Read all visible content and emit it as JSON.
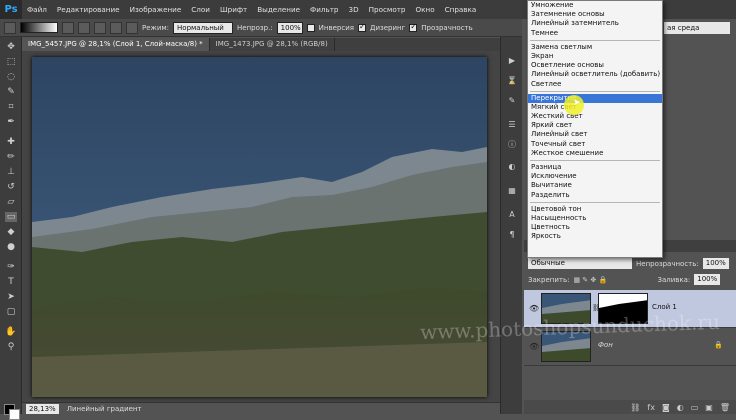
{
  "app": {
    "logo": "Ps"
  },
  "menu": [
    "Файл",
    "Редактирование",
    "Изображение",
    "Слои",
    "Шрифт",
    "Выделение",
    "Фильтр",
    "3D",
    "Просмотр",
    "Окно",
    "Справка"
  ],
  "options": {
    "mode_label": "Режим:",
    "mode_value": "Нормальный",
    "opacity_label": "Непрозр.:",
    "opacity_value": "100%",
    "inversion_label": "Инверсия",
    "dither_label": "Дизеринг",
    "transparency_label": "Прозрачность"
  },
  "workspace": {
    "value": "ая среда"
  },
  "tabs": [
    {
      "label": "IMG_5457.JPG @ 28,1% (Слой 1, Слой-маска/8) *"
    },
    {
      "label": "IMG_1473.JPG @ 28,1% (RGB/8)"
    }
  ],
  "status": {
    "zoom": "28,13%",
    "tool": "Линейный градиент"
  },
  "blend_menu": {
    "groups": [
      [
        "Умножение",
        "Затемнение основы",
        "Линейный затемнитель",
        "Темнее"
      ],
      [
        "Замена светлым",
        "Экран",
        "Осветление основы",
        "Линейный осветлитель (добавить)",
        "Светлее"
      ],
      [
        "Перекрытие",
        "Мягкий свет",
        "Жесткий свет",
        "Яркий свет",
        "Линейный свет",
        "Точечный свет",
        "Жесткое смешение"
      ],
      [
        "Разница",
        "Исключение",
        "Вычитание",
        "Разделить"
      ],
      [
        "Цветовой тон",
        "Насыщенность",
        "Цветность",
        "Яркость"
      ]
    ],
    "selected": "Перекрытие"
  },
  "layers": {
    "blend_value": "Обычные",
    "opacity_label": "Непрозрачность:",
    "opacity_value": "100%",
    "lock_label": "Закрепить:",
    "fill_label": "Заливка:",
    "fill_value": "100%",
    "items": [
      {
        "name": "Слой 1",
        "active": true
      },
      {
        "name": "Фон",
        "active": false
      }
    ]
  },
  "watermark": "www.photoshopsunduchok.ru",
  "colors": {
    "menu_bg": "#3c3c3c",
    "selection": "#3875d7",
    "ps_blue": "#31a8ff"
  }
}
